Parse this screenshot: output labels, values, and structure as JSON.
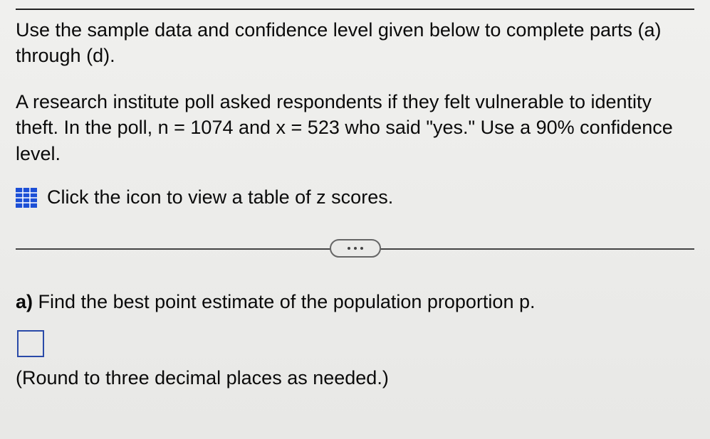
{
  "intro": {
    "line1": "Use the sample data and confidence level given below to complete parts (a) through (d)."
  },
  "problem": {
    "text": "A research institute poll asked respondents if they felt vulnerable to identity theft. In the poll, n = 1074 and x = 523 who said \"yes.\" Use a 90% confidence level."
  },
  "icon_link": {
    "label": "Click the icon to view a table of z scores."
  },
  "part_a": {
    "label": "a)",
    "prompt": "Find the best point estimate of the population proportion p.",
    "hint": "(Round to three decimal places as needed.)",
    "answer_placeholder": ""
  }
}
